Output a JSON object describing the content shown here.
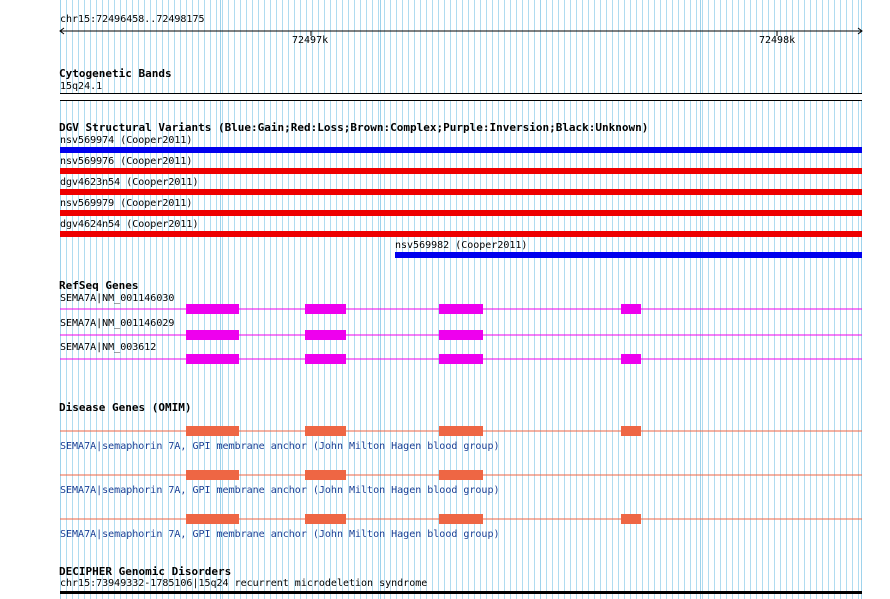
{
  "ruler": {
    "range_label": "chr15:72496458..72498175",
    "tick_labels": [
      "72497k",
      "72498k"
    ]
  },
  "cytogenetic": {
    "title": "Cytogenetic Bands",
    "band": "15q24.1"
  },
  "dgv": {
    "title": "DGV Structural Variants (Blue:Gain;Red:Loss;Brown:Complex;Purple:Inversion;Black:Unknown)",
    "variants": [
      {
        "label": "nsv569974 (Cooper2011)",
        "type": "Gain",
        "color": "#0000ee"
      },
      {
        "label": "nsv569976 (Cooper2011)",
        "type": "Loss",
        "color": "#ee0000"
      },
      {
        "label": "dgv4623n54 (Cooper2011)",
        "type": "Loss",
        "color": "#ee0000"
      },
      {
        "label": "nsv569979 (Cooper2011)",
        "type": "Loss",
        "color": "#ee0000"
      },
      {
        "label": "dgv4624n54 (Cooper2011)",
        "type": "Loss",
        "color": "#ee0000"
      },
      {
        "label": "nsv569982 (Cooper2011)",
        "type": "Gain",
        "color": "#0000ee"
      }
    ]
  },
  "refseq": {
    "title": "RefSeq Genes",
    "color": "#ee00ee",
    "genes": [
      {
        "label": "SEMA7A|NM_001146030"
      },
      {
        "label": "SEMA7A|NM_001146029"
      },
      {
        "label": "SEMA7A|NM_003612"
      }
    ]
  },
  "omim": {
    "title": "Disease Genes (OMIM)",
    "color": "#ee6644",
    "genes": [
      {
        "label": "SEMA7A|semaphorin 7A, GPI membrane anchor (John Milton Hagen blood group)"
      },
      {
        "label": "SEMA7A|semaphorin 7A, GPI membrane anchor (John Milton Hagen blood group)"
      },
      {
        "label": "SEMA7A|semaphorin 7A, GPI membrane anchor (John Milton Hagen blood group)"
      }
    ]
  },
  "decipher": {
    "title": "DECIPHER Genomic Disorders",
    "label": "chr15:73949332-1785106|15q24 recurrent microdeletion syndrome"
  }
}
